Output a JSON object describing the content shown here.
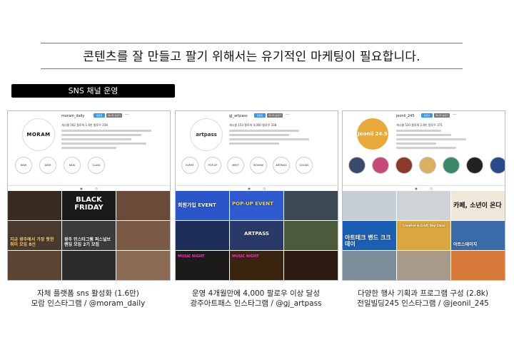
{
  "headline": "콘텐츠를 잘 만들고 팔기 위해서는 유기적인 마케팅이 필요합니다.",
  "section_tag": "SNS 채널 운영",
  "panels": [
    {
      "logo": "MORAM",
      "username": "moram_daily",
      "follow_btn": "팔로잉",
      "message_btn": "메시지 보내기",
      "stats": "게시물 562   팔로워 1.6만   팔로우 258",
      "highlights": [
        "NEW",
        "DATE",
        "KIDS",
        "CLASS"
      ],
      "posts": [
        "",
        "BLACK FRIDAY",
        "",
        "지금 광주에서 가장 핫한 취미 모임 8선",
        "광주 인스타그램 퍼스널브랜딩 모임 2기 모집",
        "",
        "",
        "",
        ""
      ],
      "caption_line1": "자체 플랫폼 sns 활성화 (1.6만)",
      "caption_line2": "모람 인스타그램 / @moram_daily"
    },
    {
      "logo": "artpass",
      "username": "gj_artpass",
      "follow_btn": "팔로잉",
      "message_btn": "메시지 보내기",
      "stats": "게시물 153   팔로워 4,000   팔로우 338",
      "highlights": [
        "EVENT",
        "POP-UP",
        "MEET",
        "REVIEW",
        "ARTPASS",
        "GOODS"
      ],
      "posts": [
        "회원가입 EVENT",
        "POP-UP EVENT",
        "",
        "",
        "ARTPASS",
        "",
        "MUSIC NIGHT",
        "MUSIC NIGHT",
        ""
      ],
      "caption_line1": "운영 4개월만에 4,000 팔로우 이상 달성",
      "caption_line2": "광주아트패스 인스타그램 / @gj_artpass"
    },
    {
      "logo": "Jeonil 24.5",
      "username": "jeonil_245",
      "follow_btn": "팔로잉",
      "message_btn": "메시지 보내기",
      "stats": "게시물 520   팔로워 2.8만   팔로우 371",
      "highlights": [
        "",
        "",
        "",
        "",
        "",
        "",
        ""
      ],
      "posts": [
        "",
        "",
        "카페, 소년이 온다",
        "아트테크 밴드 크크데이",
        "Creative & Craft Day Class",
        "아트스테이지",
        "",
        "",
        ""
      ],
      "caption_line1": "다양한 행사 기획과 프로그램 구성 (2.8k)",
      "caption_line2": "전일빌딩245 인스타그램 / @jeonil_245"
    }
  ],
  "colors": {
    "follow_btn": "#3897f0",
    "message_btn": "#777777",
    "tag_bg": "#000000",
    "moram_tiles": [
      "#3a2b22",
      "#1a1a1a",
      "#6b4a3a",
      "#4a3a2e",
      "#3b3b3b",
      "#7a5a44",
      "#5b4535",
      "#2a2a2a",
      "#8a6a52"
    ],
    "artpass_tiles": [
      "#2b56c9",
      "#2f5ad0",
      "#3d4a55",
      "#1e2e5a",
      "#2a3a68",
      "#4a5a3a",
      "#1d1a1a",
      "#3a2410",
      "#2a1a10"
    ],
    "jeonil_tiles": [
      "#c8ced6",
      "#cfd3d8",
      "#efe8da",
      "#1a5fb4",
      "#d9a640",
      "#3a6aa8",
      "#7d8c9a",
      "#a89a8a",
      "#d87a3a"
    ]
  }
}
